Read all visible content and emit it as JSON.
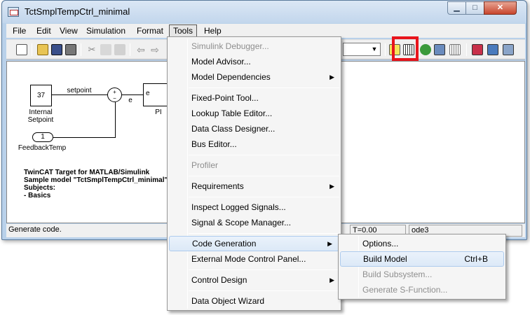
{
  "window": {
    "title": "TctSmplTempCtrl_minimal"
  },
  "menubar": [
    "File",
    "Edit",
    "View",
    "Simulation",
    "Format",
    "Tools",
    "Help"
  ],
  "toolbar": {
    "icons": [
      "new-file-icon",
      "open-folder-icon",
      "save-icon",
      "print-icon",
      "cut-icon",
      "copy-icon",
      "paste-icon",
      "back-arrow-icon",
      "forward-arrow-icon",
      "model-advisor-icon",
      "build-model-icon",
      "refresh-icon",
      "update-diagram-icon",
      "build-subsystem-icon",
      "library-browser-icon",
      "model-explorer-icon",
      "debugger-icon"
    ],
    "combo_value": ""
  },
  "diagram": {
    "constant_value": "37",
    "constant_label": "Internal\nSetpoint",
    "setpoint_signal": "setpoint",
    "sum_signs": "+\n−",
    "error_signal": "e",
    "pi_input": "e",
    "pi_label": "PI",
    "inport_number": "1",
    "inport_label": "FeedbackTemp",
    "annotation": [
      "TwinCAT Target for MATLAB/Simulink",
      "Sample model \"TctSmplTempCtrl_minimal\"",
      "Subjects:",
      "- Basics"
    ]
  },
  "status": {
    "message": "Generate code.",
    "time": "T=0.00",
    "solver": "ode3"
  },
  "tools_menu": {
    "items": [
      {
        "label": "Simulink Debugger...",
        "disabled": true
      },
      {
        "label": "Model Advisor..."
      },
      {
        "label": "Model Dependencies",
        "submenu": true
      },
      {
        "label": "Fixed-Point Tool..."
      },
      {
        "label": "Lookup Table Editor..."
      },
      {
        "label": "Data Class Designer..."
      },
      {
        "label": "Bus Editor..."
      },
      {
        "label": "Profiler",
        "disabled": true
      },
      {
        "label": "Requirements",
        "submenu": true
      },
      {
        "label": "Inspect Logged Signals..."
      },
      {
        "label": "Signal & Scope Manager..."
      },
      {
        "label": "Code Generation",
        "submenu": true,
        "highlighted": true
      },
      {
        "label": "External Mode Control Panel..."
      },
      {
        "label": "Control Design",
        "submenu": true
      },
      {
        "label": "Data Object Wizard"
      }
    ]
  },
  "code_generation_menu": {
    "items": [
      {
        "label": "Options..."
      },
      {
        "label": "Build Model",
        "shortcut": "Ctrl+B",
        "highlighted": true
      },
      {
        "label": "Build Subsystem...",
        "disabled": true
      },
      {
        "label": "Generate S-Function...",
        "disabled": true
      }
    ]
  },
  "colors": {
    "highlight_box": "#e8141c",
    "title_bar": "#c2d6ec"
  }
}
